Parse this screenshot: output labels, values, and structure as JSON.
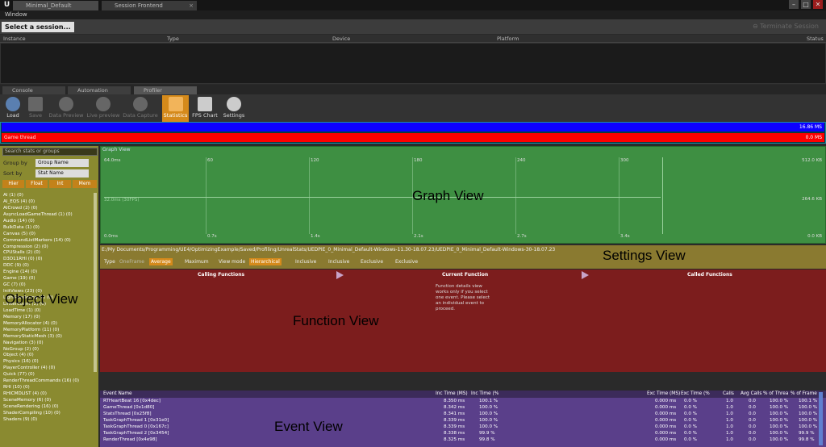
{
  "titlebar": {
    "logo": "U",
    "tabs": [
      {
        "label": "Minimal_Default"
      },
      {
        "label": "Session Frontend"
      }
    ],
    "controls": {
      "minimize": "–",
      "maximize": "□",
      "close": "✕"
    }
  },
  "menu": {
    "window": "Window"
  },
  "session": {
    "select_label": "Select a session... ▾",
    "terminate_label": "Terminate Session",
    "columns": [
      "Instance",
      "Type",
      "Device",
      "Platform",
      "Status"
    ]
  },
  "lower_tabs": [
    {
      "label": "Console"
    },
    {
      "label": "Automation"
    },
    {
      "label": "Profiler"
    }
  ],
  "toolbar": [
    {
      "label": "Load",
      "icon": "load-icon"
    },
    {
      "label": "Save",
      "icon": "save-icon"
    },
    {
      "label": "Data Preview",
      "icon": "data-preview-icon"
    },
    {
      "label": "Live preview",
      "icon": "live-preview-icon"
    },
    {
      "label": "Data Capture",
      "icon": "data-capture-icon"
    },
    {
      "label": "Statistics",
      "icon": "statistics-icon"
    },
    {
      "label": "FPS Chart",
      "icon": "fps-chart-icon"
    },
    {
      "label": "Settings",
      "icon": "settings-icon"
    }
  ],
  "top_graph": {
    "blue_label": "16.86 MS",
    "red_label": "0.0 MS",
    "red_title": "Game thread"
  },
  "left": {
    "search_placeholder": "Search stats or groups",
    "group_by_label": "Group by",
    "group_by_value": "Group Name",
    "sort_by_label": "Sort by",
    "sort_by_value": "Stat Name",
    "filters": [
      "Hier",
      "Float",
      "Int",
      "Mem"
    ],
    "tree": [
      "AI (1) (0)",
      "AI_EQS (4) (0)",
      "AICrowd (2) (0)",
      "AsyncLoadGameThread (1) (0)",
      "Audio (14) (0)",
      "BulkData (1) (0)",
      "Canvas (5) (0)",
      "CommandListMarkers (14) (0)",
      "Compression (2) (0)",
      "CPUStalls (2) (0)",
      "D3D11RHI (0) (0)",
      "DDC (9) (0)",
      "Engine (14) (0)",
      "Game (19) (0)",
      "GC (7) (0)",
      "InitViews (23) (0)",
      "LightRendering (6) (0)",
      "LinkerCount (2) (0)",
      "LoadTime (1) (0)",
      "Memory (17) (0)",
      "MemoryAllocator (4) (0)",
      "MemoryPlatform (11) (0)",
      "MemoryStaticMesh (3) (0)",
      "Navigation (3) (0)",
      "NoGroup (2) (0)",
      "Object (4) (0)",
      "Physics (16) (0)",
      "PlayerController (4) (0)",
      "Quick (77) (0)",
      "RenderThreadCommands (16) (0)",
      "RHI (10) (0)",
      "RHICMDLIST (4) (0)",
      "SceneMemory (6) (0)",
      "SceneRendering (16) (0)",
      "ShaderCompiling (10) (0)",
      "Shaders (9) (0)"
    ]
  },
  "overlays": {
    "object": "Object View",
    "graph": "Graph View",
    "settings": "Settings View",
    "function": "Function View",
    "event": "Event View"
  },
  "graph": {
    "title": "Graph View",
    "x_labels": [
      "60",
      "120",
      "180",
      "240",
      "300"
    ],
    "bottom_labels": [
      "0.0s",
      "0.7s",
      "1.4s",
      "2.1s",
      "2.7s",
      "3.4s"
    ],
    "left_labels": [
      "64.0ms",
      "0.0ms"
    ],
    "mid_label": "32.0ms (30FPS)",
    "right_labels": [
      "512.0 KB",
      "264.6 KB",
      "0.0 KB"
    ]
  },
  "settings": {
    "path": "E:/My Documents/Programming/UE4/OptimizingExample/Saved/Profiling/UnrealStats/UEDPIE_0_Minimal_Default-Windows-11.30-18.07.23/UEDPIE_0_Minimal_Default-Windows-30-18.07.23",
    "type_label": "Type",
    "options": [
      "OneFrame",
      "Average",
      "Maximum",
      "View mode",
      "Hierarchical",
      "Inclusive",
      "Inclusive",
      "Exclusive",
      "Exclusive"
    ]
  },
  "function": {
    "calling": "Calling Functions",
    "current": "Current Function",
    "called": "Called Functions",
    "message": "Function details view works only if you select one event. Please select an individual event to proceed."
  },
  "events": {
    "columns": [
      "Event Name",
      "Inc Time (MS)",
      "Inc Time (%",
      "Exc Time (MS)",
      "Exc Time (%",
      "Calls",
      "Avg Calls",
      "% of Threa",
      "% of Frame"
    ],
    "rows": [
      [
        "RTHeartBeat 16 [0x4dec]",
        "8.350 ms",
        "100.1 %",
        "0.000 ms",
        "0.0 %",
        "1.0",
        "0.0",
        "100.0 %",
        "100.1 %"
      ],
      [
        "GameThread [0x1d80]",
        "8.342 ms",
        "100.0 %",
        "0.000 ms",
        "0.0 %",
        "1.0",
        "0.0",
        "100.0 %",
        "100.0 %"
      ],
      [
        "StatsThread [0x25f8]",
        "8.341 ms",
        "100.0 %",
        "0.000 ms",
        "0.0 %",
        "1.0",
        "0.0",
        "100.0 %",
        "100.0 %"
      ],
      [
        "TaskGraphThread 1 [0x31e0]",
        "8.339 ms",
        "100.0 %",
        "0.000 ms",
        "0.0 %",
        "1.0",
        "0.0",
        "100.0 %",
        "100.0 %"
      ],
      [
        "TaskGraphThread 0 [0x167c]",
        "8.339 ms",
        "100.0 %",
        "0.000 ms",
        "0.0 %",
        "1.0",
        "0.0",
        "100.0 %",
        "100.0 %"
      ],
      [
        "TaskGraphThread 2 [0x3454]",
        "8.338 ms",
        "99.9 %",
        "0.000 ms",
        "0.0 %",
        "1.0",
        "0.0",
        "100.0 %",
        "99.9 %"
      ],
      [
        "RenderThread [0x4e98]",
        "8.325 ms",
        "99.8 %",
        "0.000 ms",
        "0.0 %",
        "1.0",
        "0.0",
        "100.0 %",
        "99.8 %"
      ]
    ]
  }
}
